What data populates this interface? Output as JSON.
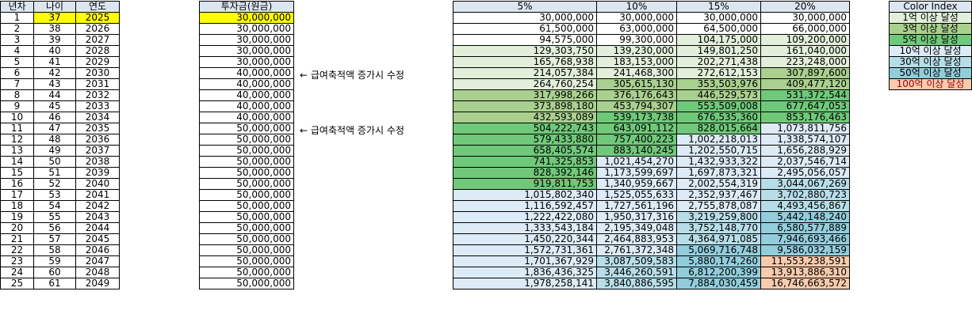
{
  "headers": {
    "year_no": "년차",
    "age": "나이",
    "year": "연도",
    "investment": "투자금(원금)",
    "rates": [
      "5%",
      "10%",
      "15%",
      "20%"
    ],
    "color_index": "Color Index"
  },
  "rows": [
    [
      "1",
      "37",
      "2025",
      "30,000,000",
      "30,000,000",
      "30,000,000",
      "30,000,000",
      "30,000,000"
    ],
    [
      "2",
      "38",
      "2026",
      "30,000,000",
      "61,500,000",
      "63,000,000",
      "64,500,000",
      "66,000,000"
    ],
    [
      "3",
      "39",
      "2027",
      "30,000,000",
      "94,575,000",
      "99,300,000",
      "104,175,000",
      "109,200,000"
    ],
    [
      "4",
      "40",
      "2028",
      "30,000,000",
      "129,303,750",
      "139,230,000",
      "149,801,250",
      "161,040,000"
    ],
    [
      "5",
      "41",
      "2029",
      "30,000,000",
      "165,768,938",
      "183,153,000",
      "202,271,438",
      "223,248,000"
    ],
    [
      "6",
      "42",
      "2030",
      "40,000,000",
      "214,057,384",
      "241,468,300",
      "272,612,153",
      "307,897,600"
    ],
    [
      "7",
      "43",
      "2031",
      "40,000,000",
      "264,760,254",
      "305,615,130",
      "353,503,976",
      "409,477,120"
    ],
    [
      "8",
      "44",
      "2032",
      "40,000,000",
      "317,998,266",
      "376,176,643",
      "446,529,573",
      "531,372,544"
    ],
    [
      "9",
      "45",
      "2033",
      "40,000,000",
      "373,898,180",
      "453,794,307",
      "553,509,008",
      "677,647,053"
    ],
    [
      "10",
      "46",
      "2034",
      "40,000,000",
      "432,593,089",
      "539,173,738",
      "676,535,360",
      "853,176,463"
    ],
    [
      "11",
      "47",
      "2035",
      "50,000,000",
      "504,222,743",
      "643,091,112",
      "828,015,664",
      "1,073,811,756"
    ],
    [
      "12",
      "48",
      "2036",
      "50,000,000",
      "579,433,880",
      "757,400,223",
      "1,002,218,013",
      "1,338,574,107"
    ],
    [
      "13",
      "49",
      "2037",
      "50,000,000",
      "658,405,574",
      "883,140,245",
      "1,202,550,715",
      "1,656,288,929"
    ],
    [
      "14",
      "50",
      "2038",
      "50,000,000",
      "741,325,853",
      "1,021,454,270",
      "1,432,933,322",
      "2,037,546,714"
    ],
    [
      "15",
      "51",
      "2039",
      "50,000,000",
      "828,392,146",
      "1,173,599,697",
      "1,697,873,321",
      "2,495,056,057"
    ],
    [
      "16",
      "52",
      "2040",
      "50,000,000",
      "919,811,753",
      "1,340,959,667",
      "2,002,554,319",
      "3,044,067,269"
    ],
    [
      "17",
      "53",
      "2041",
      "50,000,000",
      "1,015,802,340",
      "1,525,055,633",
      "2,352,937,467",
      "3,702,880,723"
    ],
    [
      "18",
      "54",
      "2042",
      "50,000,000",
      "1,116,592,457",
      "1,727,561,196",
      "2,755,878,087",
      "4,493,456,867"
    ],
    [
      "19",
      "55",
      "2043",
      "50,000,000",
      "1,222,422,080",
      "1,950,317,316",
      "3,219,259,800",
      "5,442,148,240"
    ],
    [
      "20",
      "56",
      "2044",
      "50,000,000",
      "1,333,543,184",
      "2,195,349,048",
      "3,752,148,770",
      "6,580,577,889"
    ],
    [
      "21",
      "57",
      "2045",
      "50,000,000",
      "1,450,220,344",
      "2,464,883,953",
      "4,364,971,085",
      "7,946,693,466"
    ],
    [
      "22",
      "58",
      "2046",
      "50,000,000",
      "1,572,731,361",
      "2,761,372,348",
      "5,069,716,748",
      "9,586,032,159"
    ],
    [
      "23",
      "59",
      "2047",
      "50,000,000",
      "1,701,367,929",
      "3,087,509,583",
      "5,880,174,260",
      "11,553,238,591"
    ],
    [
      "24",
      "60",
      "2048",
      "50,000,000",
      "1,836,436,325",
      "3,446,260,591",
      "6,812,200,399",
      "13,913,886,310"
    ],
    [
      "25",
      "61",
      "2049",
      "50,000,000",
      "1,978,258,141",
      "3,840,886,595",
      "7,884,030,459",
      "16,746,663,572"
    ]
  ],
  "notes": [
    {
      "row": 6,
      "text": "← 급여축적액 증가시 수정"
    },
    {
      "row": 11,
      "text": "← 급여축적액 증가시 수정"
    }
  ],
  "legend": [
    {
      "label": "1억 이상 달성",
      "color": "#e2efda"
    },
    {
      "label": "3억 이상 달성",
      "color": "#a9d08e"
    },
    {
      "label": "5억 이상 달성",
      "color": "#70c97a"
    },
    {
      "label": "10억 이상 달성",
      "color": "#ddebf7"
    },
    {
      "label": "30억 이상 달성",
      "color": "#b7dee8"
    },
    {
      "label": "50억 이상 달성",
      "color": "#92cddc"
    },
    {
      "label": "100억 이상 달성",
      "color": "#f8cbad"
    }
  ]
}
